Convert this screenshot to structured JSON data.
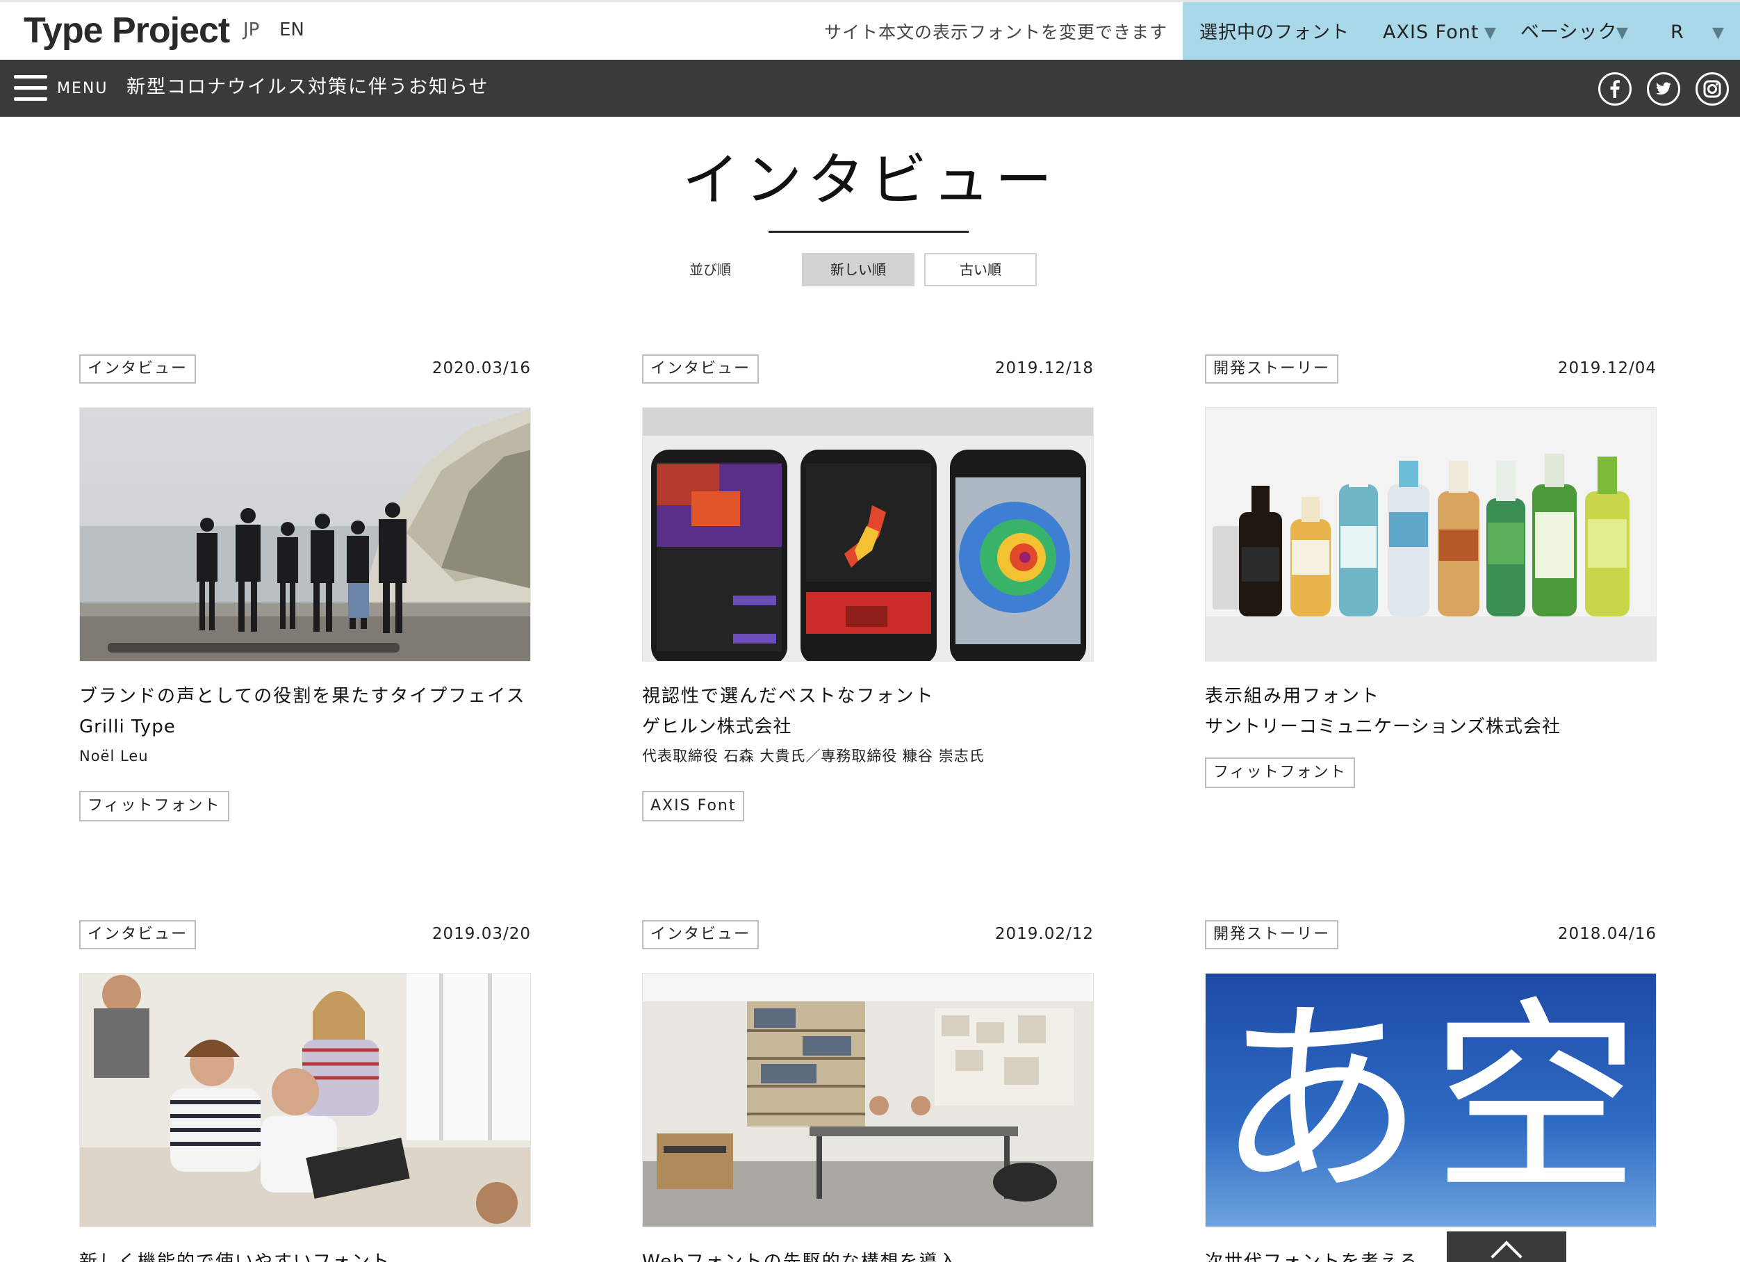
{
  "header": {
    "logo": "Type Project",
    "lang_jp": "JP",
    "lang_en": "EN",
    "font_note": "サイト本文の表示フォントを変更できます",
    "font_panel": {
      "label": "選択中のフォント",
      "font": "AXIS Font",
      "weight": "ベーシック",
      "style": "R"
    }
  },
  "nav": {
    "menu_label": "MENU",
    "notice": "新型コロナウイルス対策に伴うお知らせ",
    "social": [
      "facebook-icon",
      "twitter-icon",
      "instagram-icon"
    ]
  },
  "page": {
    "title": "インタビュー",
    "sort_label": "並び順",
    "sort_new": "新しい順",
    "sort_old": "古い順"
  },
  "cards": [
    {
      "tag": "インタビュー",
      "date": "2020.03/16",
      "title": "ブランドの声としての役割を果たすタイプフェイス",
      "subtitle": "Grilli Type",
      "person": "Noël Leu",
      "font": "フィットフォント"
    },
    {
      "tag": "インタビュー",
      "date": "2019.12/18",
      "title": "視認性で選んだベストなフォント",
      "subtitle": "ゲヒルン株式会社",
      "person": "代表取締役 石森 大貴氏／専務取締役 糠谷 崇志氏",
      "font": "AXIS Font"
    },
    {
      "tag": "開発ストーリー",
      "date": "2019.12/04",
      "title": "表示組み用フォント",
      "subtitle": "サントリーコミュニケーションズ株式会社",
      "person": "",
      "font": "フィットフォント"
    },
    {
      "tag": "インタビュー",
      "date": "2019.03/20",
      "title": "新しく機能的で使いやすいフォント"
    },
    {
      "tag": "インタビュー",
      "date": "2019.02/12",
      "title": "Webフォントの先駆的な構想を導入"
    },
    {
      "tag": "開発ストーリー",
      "date": "2018.04/16",
      "title": "次世代フォントを考える",
      "thumb_text": "あ空"
    }
  ],
  "colors": {
    "nav_bg": "#3a3a3a",
    "font_panel_bg": "#a9d8e8",
    "sort_active_bg": "#d2d2d2",
    "blue_thumb": "#1f4fa8"
  }
}
